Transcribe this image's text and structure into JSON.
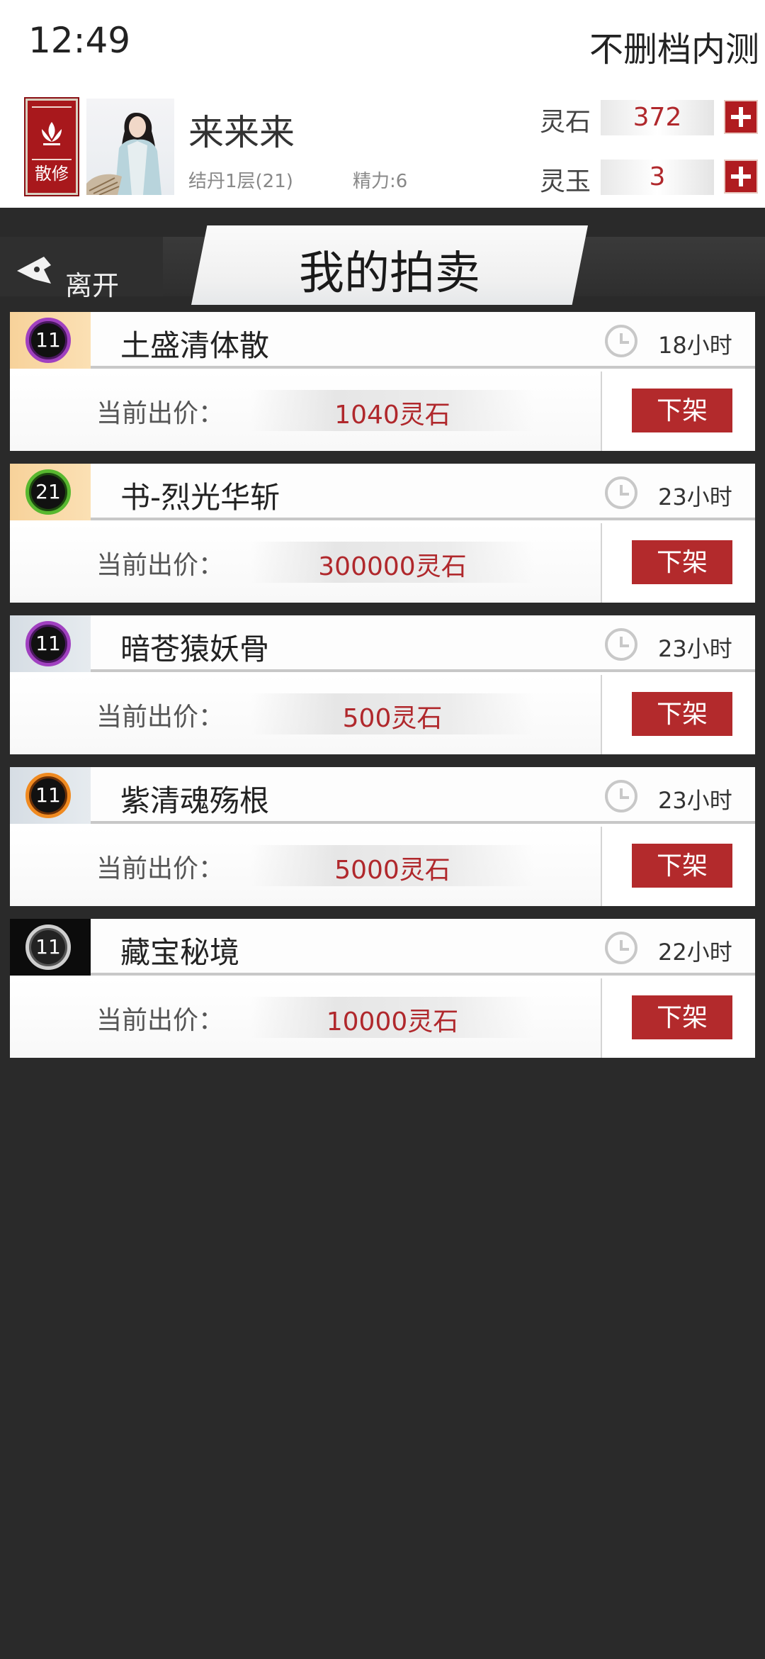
{
  "status": {
    "time": "12:49",
    "server": "不删档内测"
  },
  "player": {
    "sect": "散修",
    "name": "来来来",
    "realm": "结丹1层(21)",
    "stamina": "精力:6"
  },
  "currency": [
    {
      "label": "灵石",
      "value": "372"
    },
    {
      "label": "灵玉",
      "value": "3"
    }
  ],
  "title_bar": {
    "back_label": "离开",
    "title": "我的拍卖"
  },
  "price_label": "当前出价：",
  "delist_label": "下架",
  "listings": [
    {
      "level": "11",
      "name": "土盛清体散",
      "time_left": "18小时",
      "price": "1040灵石",
      "rarity": "purple",
      "tab": "gold"
    },
    {
      "level": "21",
      "name": "书-烈光华斩",
      "time_left": "23小时",
      "price": "300000灵石",
      "rarity": "green",
      "tab": "gold"
    },
    {
      "level": "11",
      "name": "暗苍猿妖骨",
      "time_left": "23小时",
      "price": "500灵石",
      "rarity": "purple",
      "tab": "gray"
    },
    {
      "level": "11",
      "name": "紫清魂殇根",
      "time_left": "23小时",
      "price": "5000灵石",
      "rarity": "orange",
      "tab": "gray"
    },
    {
      "level": "11",
      "name": "藏宝秘境",
      "time_left": "22小时",
      "price": "10000灵石",
      "rarity": "white",
      "tab": "black"
    }
  ],
  "colors": {
    "accent_red": "#b32a2c",
    "price_red": "#b0282c",
    "background": "#2a2a2a"
  }
}
